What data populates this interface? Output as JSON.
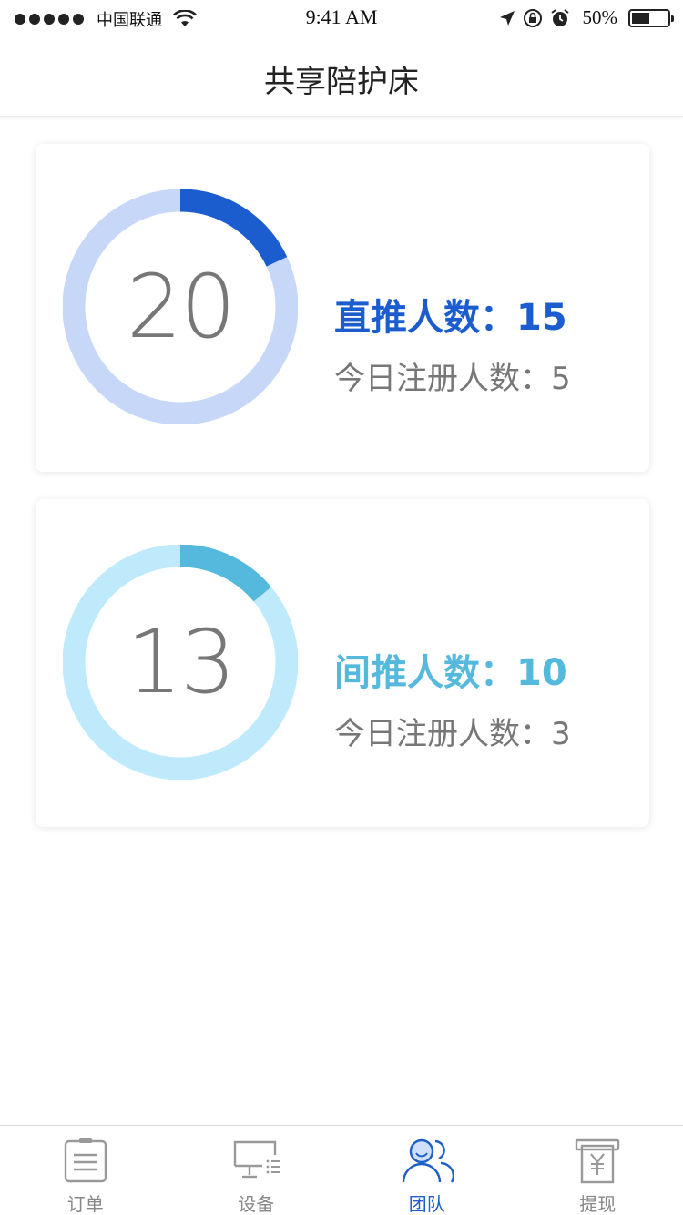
{
  "status_bar": {
    "carrier": "中国联通",
    "time": "9:41 AM",
    "battery_percent_label": "50%",
    "battery_level": 0.5
  },
  "header": {
    "title": "共享陪护床"
  },
  "cards": [
    {
      "ring_value": "20",
      "ring_progress": 0.18,
      "main_label": "直推人数：15",
      "sub_label": "今日注册人数：5",
      "accent_color": "#1b5dcf",
      "track_color": "#c6d7f7"
    },
    {
      "ring_value": "13",
      "ring_progress": 0.14,
      "main_label": "间推人数：10",
      "sub_label": "今日注册人数：3",
      "accent_color": "#54b9dc",
      "track_color": "#bfeafb"
    }
  ],
  "tab_bar": {
    "items": [
      {
        "label": "订单",
        "icon": "order-list-icon",
        "active": false
      },
      {
        "label": "设备",
        "icon": "device-monitor-icon",
        "active": false
      },
      {
        "label": "团队",
        "icon": "team-people-icon",
        "active": true
      },
      {
        "label": "提现",
        "icon": "withdraw-yuan-icon",
        "active": false
      }
    ],
    "active_color": "#1f5fc8",
    "inactive_color": "#888888"
  }
}
